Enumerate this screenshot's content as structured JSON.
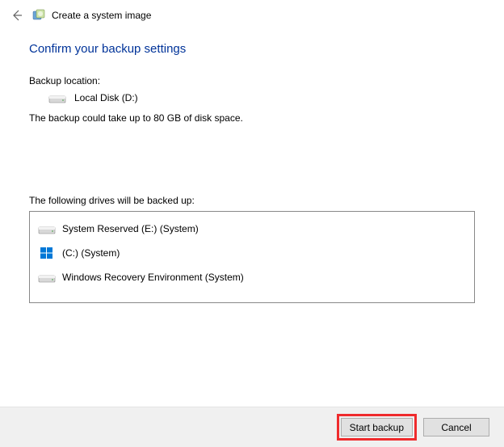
{
  "titlebar": {
    "title": "Create a system image"
  },
  "heading": "Confirm your backup settings",
  "backup_location_label": "Backup location:",
  "backup_location_value": "Local Disk (D:)",
  "size_info": "The backup could take up to 80 GB of disk space.",
  "drives_label": "The following drives will be backed up:",
  "drives": [
    {
      "icon": "disk",
      "label": "System Reserved (E:) (System)"
    },
    {
      "icon": "windisk",
      "label": "(C:) (System)"
    },
    {
      "icon": "disk",
      "label": "Windows Recovery Environment (System)"
    }
  ],
  "buttons": {
    "start": "Start backup",
    "cancel": "Cancel"
  }
}
